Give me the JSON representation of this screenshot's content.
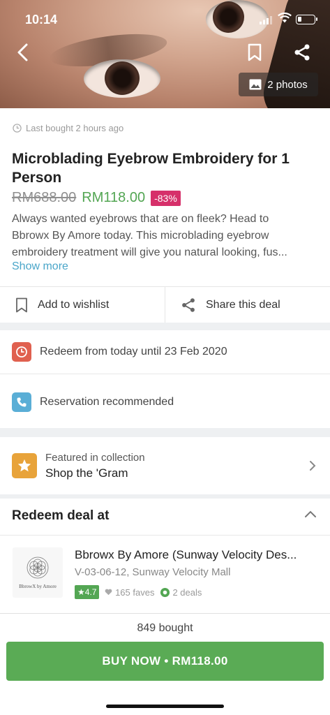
{
  "status_bar": {
    "time": "10:14"
  },
  "hero": {
    "photos_label": "2 photos"
  },
  "deal": {
    "last_bought": "Last bought 2 hours ago",
    "title": "Microblading Eyebrow Embroidery for 1 Person",
    "old_price": "RM688.00",
    "new_price": "RM118.00",
    "discount": "-83%",
    "description_lines": [
      "Always wanted eyebrows that are on fleek? Head to",
      "Bbrowx By Amore today. This microblading eyebrow",
      "embroidery treatment will give you natural looking, fus..."
    ],
    "show_more": "Show more"
  },
  "actions": {
    "wishlist": "Add to wishlist",
    "share": "Share this deal"
  },
  "info": {
    "redeem_period": "Redeem from today until 23 Feb 2020",
    "reservation": "Reservation recommended"
  },
  "featured": {
    "subtitle": "Featured in collection",
    "collection": "Shop the 'Gram"
  },
  "redeem_section": {
    "heading": "Redeem deal at",
    "merchant": {
      "logo_text": "BbrowX by Amore",
      "name": "Bbrowx By Amore (Sunway Velocity Des...",
      "address": "V-03-06-12, Sunway Velocity Mall",
      "rating": "4.7",
      "faves": "165 faves",
      "deals": "2 deals"
    }
  },
  "footer": {
    "bought": "849 bought",
    "buy_button": "BUY NOW • RM118.00"
  },
  "colors": {
    "accent_green": "#53a653",
    "discount_pink": "#d6306a",
    "link_blue": "#4aa6c9",
    "clock_red": "#e0604f",
    "phone_blue": "#5aaed6",
    "star_orange": "#e8a33a"
  },
  "icons": [
    "back-arrow-icon",
    "bookmark-icon",
    "share-icon",
    "photo-icon",
    "clock-icon",
    "phone-icon",
    "star-icon",
    "chevron-right-icon",
    "chevron-up-icon",
    "heart-icon",
    "deals-icon"
  ]
}
